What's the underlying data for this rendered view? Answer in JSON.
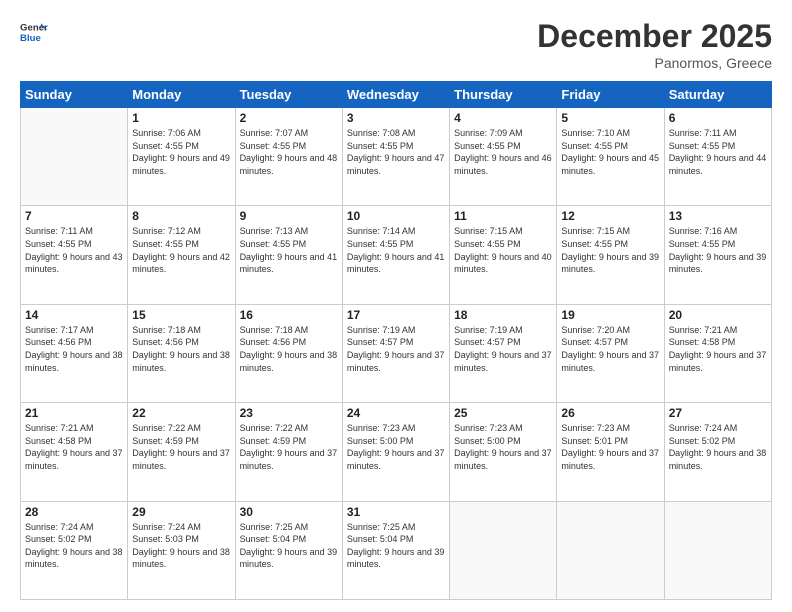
{
  "header": {
    "logo_line1": "General",
    "logo_line2": "Blue",
    "month": "December 2025",
    "location": "Panormos, Greece"
  },
  "weekdays": [
    "Sunday",
    "Monday",
    "Tuesday",
    "Wednesday",
    "Thursday",
    "Friday",
    "Saturday"
  ],
  "weeks": [
    [
      {
        "day": "",
        "empty": true
      },
      {
        "day": "1",
        "sunrise": "7:06 AM",
        "sunset": "4:55 PM",
        "daylight": "9 hours and 49 minutes."
      },
      {
        "day": "2",
        "sunrise": "7:07 AM",
        "sunset": "4:55 PM",
        "daylight": "9 hours and 48 minutes."
      },
      {
        "day": "3",
        "sunrise": "7:08 AM",
        "sunset": "4:55 PM",
        "daylight": "9 hours and 47 minutes."
      },
      {
        "day": "4",
        "sunrise": "7:09 AM",
        "sunset": "4:55 PM",
        "daylight": "9 hours and 46 minutes."
      },
      {
        "day": "5",
        "sunrise": "7:10 AM",
        "sunset": "4:55 PM",
        "daylight": "9 hours and 45 minutes."
      },
      {
        "day": "6",
        "sunrise": "7:11 AM",
        "sunset": "4:55 PM",
        "daylight": "9 hours and 44 minutes."
      }
    ],
    [
      {
        "day": "7",
        "sunrise": "7:11 AM",
        "sunset": "4:55 PM",
        "daylight": "9 hours and 43 minutes."
      },
      {
        "day": "8",
        "sunrise": "7:12 AM",
        "sunset": "4:55 PM",
        "daylight": "9 hours and 42 minutes."
      },
      {
        "day": "9",
        "sunrise": "7:13 AM",
        "sunset": "4:55 PM",
        "daylight": "9 hours and 41 minutes."
      },
      {
        "day": "10",
        "sunrise": "7:14 AM",
        "sunset": "4:55 PM",
        "daylight": "9 hours and 41 minutes."
      },
      {
        "day": "11",
        "sunrise": "7:15 AM",
        "sunset": "4:55 PM",
        "daylight": "9 hours and 40 minutes."
      },
      {
        "day": "12",
        "sunrise": "7:15 AM",
        "sunset": "4:55 PM",
        "daylight": "9 hours and 39 minutes."
      },
      {
        "day": "13",
        "sunrise": "7:16 AM",
        "sunset": "4:55 PM",
        "daylight": "9 hours and 39 minutes."
      }
    ],
    [
      {
        "day": "14",
        "sunrise": "7:17 AM",
        "sunset": "4:56 PM",
        "daylight": "9 hours and 38 minutes."
      },
      {
        "day": "15",
        "sunrise": "7:18 AM",
        "sunset": "4:56 PM",
        "daylight": "9 hours and 38 minutes."
      },
      {
        "day": "16",
        "sunrise": "7:18 AM",
        "sunset": "4:56 PM",
        "daylight": "9 hours and 38 minutes."
      },
      {
        "day": "17",
        "sunrise": "7:19 AM",
        "sunset": "4:57 PM",
        "daylight": "9 hours and 37 minutes."
      },
      {
        "day": "18",
        "sunrise": "7:19 AM",
        "sunset": "4:57 PM",
        "daylight": "9 hours and 37 minutes."
      },
      {
        "day": "19",
        "sunrise": "7:20 AM",
        "sunset": "4:57 PM",
        "daylight": "9 hours and 37 minutes."
      },
      {
        "day": "20",
        "sunrise": "7:21 AM",
        "sunset": "4:58 PM",
        "daylight": "9 hours and 37 minutes."
      }
    ],
    [
      {
        "day": "21",
        "sunrise": "7:21 AM",
        "sunset": "4:58 PM",
        "daylight": "9 hours and 37 minutes."
      },
      {
        "day": "22",
        "sunrise": "7:22 AM",
        "sunset": "4:59 PM",
        "daylight": "9 hours and 37 minutes."
      },
      {
        "day": "23",
        "sunrise": "7:22 AM",
        "sunset": "4:59 PM",
        "daylight": "9 hours and 37 minutes."
      },
      {
        "day": "24",
        "sunrise": "7:23 AM",
        "sunset": "5:00 PM",
        "daylight": "9 hours and 37 minutes."
      },
      {
        "day": "25",
        "sunrise": "7:23 AM",
        "sunset": "5:00 PM",
        "daylight": "9 hours and 37 minutes."
      },
      {
        "day": "26",
        "sunrise": "7:23 AM",
        "sunset": "5:01 PM",
        "daylight": "9 hours and 37 minutes."
      },
      {
        "day": "27",
        "sunrise": "7:24 AM",
        "sunset": "5:02 PM",
        "daylight": "9 hours and 38 minutes."
      }
    ],
    [
      {
        "day": "28",
        "sunrise": "7:24 AM",
        "sunset": "5:02 PM",
        "daylight": "9 hours and 38 minutes."
      },
      {
        "day": "29",
        "sunrise": "7:24 AM",
        "sunset": "5:03 PM",
        "daylight": "9 hours and 38 minutes."
      },
      {
        "day": "30",
        "sunrise": "7:25 AM",
        "sunset": "5:04 PM",
        "daylight": "9 hours and 39 minutes."
      },
      {
        "day": "31",
        "sunrise": "7:25 AM",
        "sunset": "5:04 PM",
        "daylight": "9 hours and 39 minutes."
      },
      {
        "day": "",
        "empty": true
      },
      {
        "day": "",
        "empty": true
      },
      {
        "day": "",
        "empty": true
      }
    ]
  ]
}
